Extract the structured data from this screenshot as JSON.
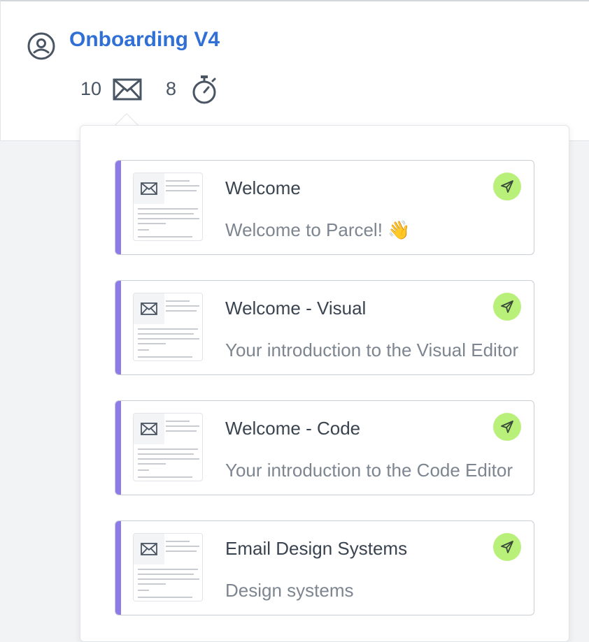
{
  "flow": {
    "title": "Onboarding V4",
    "icon": "user-circle-icon",
    "stats": {
      "emails_count": "10",
      "emails_icon": "envelope-icon",
      "delays_count": "8",
      "delays_icon": "stopwatch-icon"
    }
  },
  "colors": {
    "title": "#2f6fd6",
    "accent": "#8d7ce8",
    "send_badge": "#b8f07a"
  },
  "emails": [
    {
      "title": "Welcome",
      "subject": "Welcome to Parcel! 👋",
      "status_icon": "send-icon"
    },
    {
      "title": "Welcome - Visual",
      "subject": "Your introduction to the Visual Editor",
      "status_icon": "send-icon"
    },
    {
      "title": "Welcome - Code",
      "subject": "Your introduction to the Code Editor",
      "status_icon": "send-icon"
    },
    {
      "title": "Email Design Systems",
      "subject": "Design systems",
      "status_icon": "send-icon"
    }
  ]
}
